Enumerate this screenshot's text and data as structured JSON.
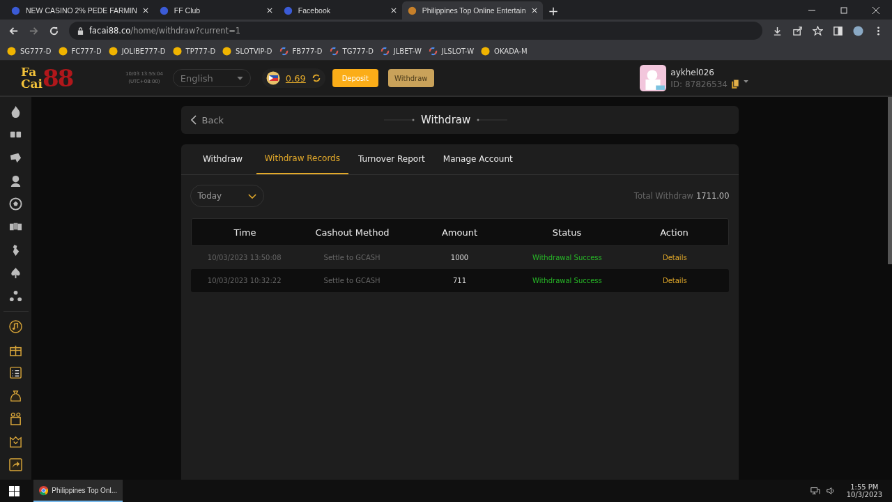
{
  "browser": {
    "tabs": [
      {
        "title": "NEW CASINO 2% PEDE FARMIN",
        "selected": false
      },
      {
        "title": "FF Club",
        "selected": false
      },
      {
        "title": "Facebook",
        "selected": false
      },
      {
        "title": "Philippines Top Online Entertain",
        "selected": true
      }
    ],
    "new_tab": "+",
    "url_host": "facai88.co",
    "url_path": "/home/withdraw?current=1",
    "bookmarks": [
      {
        "label": "SG777-D",
        "kind": "coin"
      },
      {
        "label": "FC777-D",
        "kind": "coin"
      },
      {
        "label": "JOLIBE777-D",
        "kind": "coin"
      },
      {
        "label": "TP777-D",
        "kind": "coin"
      },
      {
        "label": "SLOTVIP-D",
        "kind": "coin"
      },
      {
        "label": "FB777-D",
        "kind": "ring"
      },
      {
        "label": "TG777-D",
        "kind": "ring"
      },
      {
        "label": "JLBET-W",
        "kind": "ring"
      },
      {
        "label": "JLSLOT-W",
        "kind": "ring"
      },
      {
        "label": "OKADA-M",
        "kind": "coin"
      }
    ]
  },
  "header": {
    "logo": [
      "Fa",
      "Cai",
      "88"
    ],
    "datetime": "10/03 13:55:04",
    "timezone": "(UTC+08:00)",
    "language": "English",
    "balance": "0.69",
    "deposit": "Deposit",
    "withdraw": "Withdraw",
    "username": "aykhel026",
    "user_id": "ID: 87826534"
  },
  "page": {
    "back": "Back",
    "title": "Withdraw",
    "tabs": [
      {
        "label": "Withdraw",
        "selected": false
      },
      {
        "label": "Withdraw Records",
        "selected": true
      },
      {
        "label": "Turnover Report",
        "selected": false
      },
      {
        "label": "Manage Account",
        "selected": false
      }
    ],
    "date_filter": "Today",
    "total_label": "Total Withdraw",
    "total_value": "1711.00",
    "table": {
      "columns": [
        "Time",
        "Cashout Method",
        "Amount",
        "Status",
        "Action"
      ],
      "rows": [
        {
          "time": "10/03/2023 13:50:08",
          "method": "Settle to GCASH",
          "amount": "1000",
          "status": "Withdrawal Success",
          "action": "Details"
        },
        {
          "time": "10/03/2023 10:32:22",
          "method": "Settle to GCASH",
          "amount": "711",
          "status": "Withdrawal Success",
          "action": "Details"
        }
      ]
    }
  },
  "taskbar": {
    "app": "Philippines Top Onl...",
    "time": "1:55 PM",
    "date": "10/3/2023"
  }
}
